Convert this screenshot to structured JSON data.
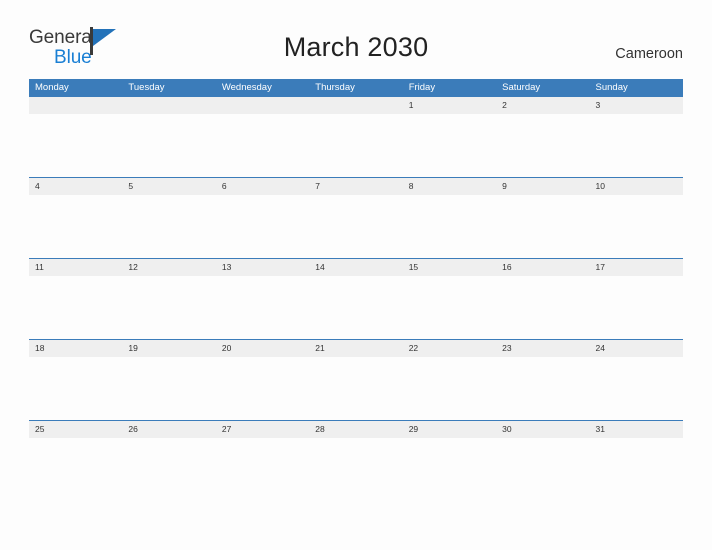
{
  "brand": {
    "name_part1": "General",
    "name_part2": "Blue",
    "mark_icon": "blue-flag-triangle-icon",
    "mark_color": "#2372b9"
  },
  "header": {
    "title": "March 2030",
    "country": "Cameroon"
  },
  "calendar": {
    "month": "March",
    "year": "2030",
    "weekday_headers": [
      "Monday",
      "Tuesday",
      "Wednesday",
      "Thursday",
      "Friday",
      "Saturday",
      "Sunday"
    ],
    "header_color": "#3b7cba",
    "band_color": "#efefef",
    "weeks": [
      {
        "days": [
          "",
          "",
          "",
          "",
          "1",
          "2",
          "3"
        ]
      },
      {
        "days": [
          "4",
          "5",
          "6",
          "7",
          "8",
          "9",
          "10"
        ]
      },
      {
        "days": [
          "11",
          "12",
          "13",
          "14",
          "15",
          "16",
          "17"
        ]
      },
      {
        "days": [
          "18",
          "19",
          "20",
          "21",
          "22",
          "23",
          "24"
        ]
      },
      {
        "days": [
          "25",
          "26",
          "27",
          "28",
          "29",
          "30",
          "31"
        ]
      }
    ]
  }
}
